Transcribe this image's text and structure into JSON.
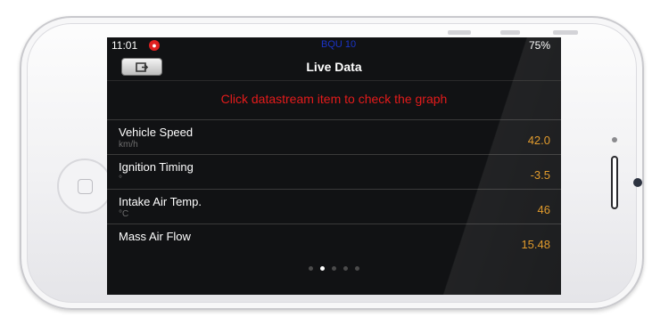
{
  "status_bar": {
    "time": "11:01",
    "alert_icon": "record-icon",
    "carrier": "BQU 10",
    "battery": "75%"
  },
  "nav_bar": {
    "back_icon": "back-icon",
    "title": "Live Data"
  },
  "hint_text": "Click datastream item to check the graph",
  "data_items": [
    {
      "name": "Vehicle Speed",
      "unit": "km/h",
      "value": "42.0"
    },
    {
      "name": "Ignition Timing",
      "unit": "°",
      "value": "-3.5"
    },
    {
      "name": "Intake Air Temp.",
      "unit": "°C",
      "value": "46"
    },
    {
      "name": "Mass Air Flow",
      "unit": "",
      "value": "15.48"
    }
  ],
  "pagination": {
    "pages": 5,
    "current": 2
  },
  "colors": {
    "hint": "#e41b1b",
    "value": "#e0951f",
    "screen_bg": "#111214"
  }
}
